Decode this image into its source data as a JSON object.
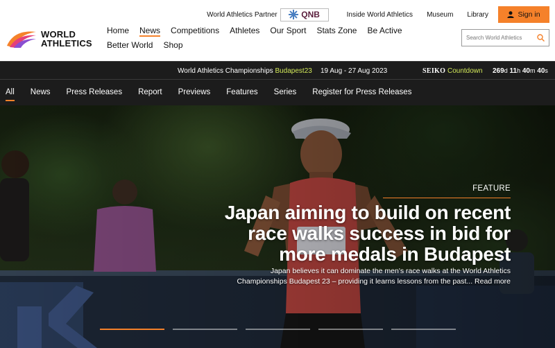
{
  "brand": {
    "line1": "WORLD",
    "line2": "ATHLETICS"
  },
  "top_bar": {
    "partner_label": "World Athletics Partner",
    "partner_name": "QNB",
    "links": [
      "Inside World Athletics",
      "Museum",
      "Library"
    ],
    "signin_label": "Sign in"
  },
  "main_nav": {
    "items": [
      "Home",
      "News",
      "Competitions",
      "Athletes",
      "Our Sport",
      "Stats Zone",
      "Be Active",
      "Better World",
      "Shop"
    ],
    "active": "News"
  },
  "search": {
    "placeholder": "Search World Athletics"
  },
  "championships": {
    "title": "World Athletics Championships",
    "title_highlight": "Budapest23",
    "dates": "19 Aug - 27 Aug 2023",
    "sponsor": "SEIKO",
    "countdown_label": "Countdown",
    "countdown": {
      "days": "269",
      "days_unit": "d",
      "hours": "11",
      "hours_unit": "h",
      "minutes": "40",
      "minutes_unit": "m",
      "seconds": "40",
      "seconds_unit": "s"
    }
  },
  "sub_nav": {
    "items": [
      "All",
      "News",
      "Press Releases",
      "Report",
      "Previews",
      "Features",
      "Series",
      "Register for Press Releases"
    ],
    "active": "All"
  },
  "hero": {
    "label": "FEATURE",
    "headline": "Japan aiming to build on recent race walks success in bid for more medals in Budapest",
    "summary": "Japan believes it can dominate the men's race walks at the World Athletics Championships Budapest 23 – providing it learns lessons from the past... Read more",
    "slides": 5,
    "active_slide": 1
  },
  "colors": {
    "accent": "#f5812a",
    "highlight": "#d2e85a",
    "dark_bar": "#1c1c1c"
  }
}
